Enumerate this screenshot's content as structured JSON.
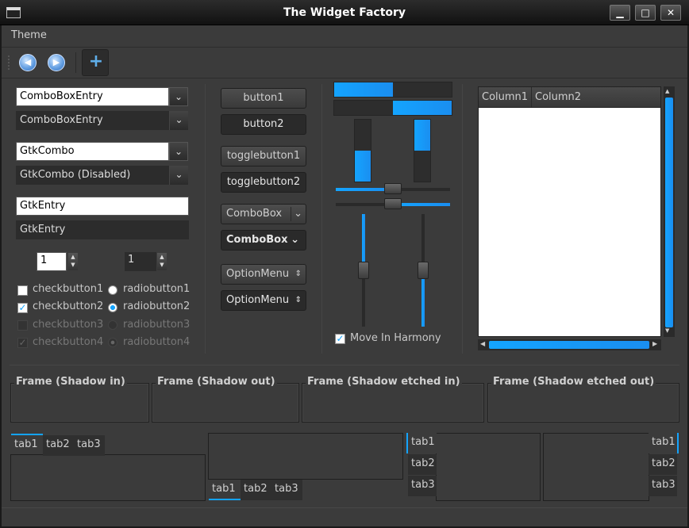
{
  "window": {
    "title": "The Widget Factory",
    "controls": {
      "minimize": "▁",
      "maximize": "□",
      "close": "✕"
    }
  },
  "menubar": {
    "items": [
      "Theme"
    ]
  },
  "toolbar": {
    "buttons": [
      "go-back-icon",
      "go-forward-icon",
      "add-icon"
    ]
  },
  "left": {
    "combo_entry1": "ComboBoxEntry",
    "combo_entry2": "ComboBoxEntry",
    "gtkcombo1": "GtkCombo",
    "gtkcombo2": "GtkCombo (Disabled)",
    "entry1": "GtkEntry",
    "entry2": "GtkEntry",
    "spin1": "1",
    "spin2": "1",
    "checks": [
      "checkbutton1",
      "checkbutton2",
      "checkbutton3",
      "checkbutton4"
    ],
    "radios": [
      "radiobutton1",
      "radiobutton2",
      "radiobutton3",
      "radiobutton4"
    ]
  },
  "buttons": {
    "button1": "button1",
    "button2": "button2",
    "toggle1": "togglebutton1",
    "toggle2": "togglebutton2",
    "combobox1": "ComboBox",
    "combobox2": "ComboBox",
    "option1": "OptionMenu",
    "option2": "OptionMenu"
  },
  "ranges": {
    "harmony_label": "Move In Harmony",
    "harmony_checked": true,
    "progress_h1": 0.5,
    "progress_h2": 0.5,
    "progress_v1": 0.5,
    "progress_v2": 0.5,
    "hscale1": 0.5,
    "hscale2": 0.5,
    "vscale1": 0.5,
    "vscale2": 0.5
  },
  "tree": {
    "columns": [
      "Column1",
      "Column2"
    ]
  },
  "frames": [
    "Frame (Shadow in)",
    "Frame (Shadow out)",
    "Frame (Shadow etched in)",
    "Frame (Shadow etched out)"
  ],
  "notebooks": {
    "tabs": [
      "tab1",
      "tab2",
      "tab3"
    ]
  },
  "colors": {
    "accent": "#14a4ff",
    "background": "#3b3b3b",
    "titlebar": "#1a1a1a"
  }
}
